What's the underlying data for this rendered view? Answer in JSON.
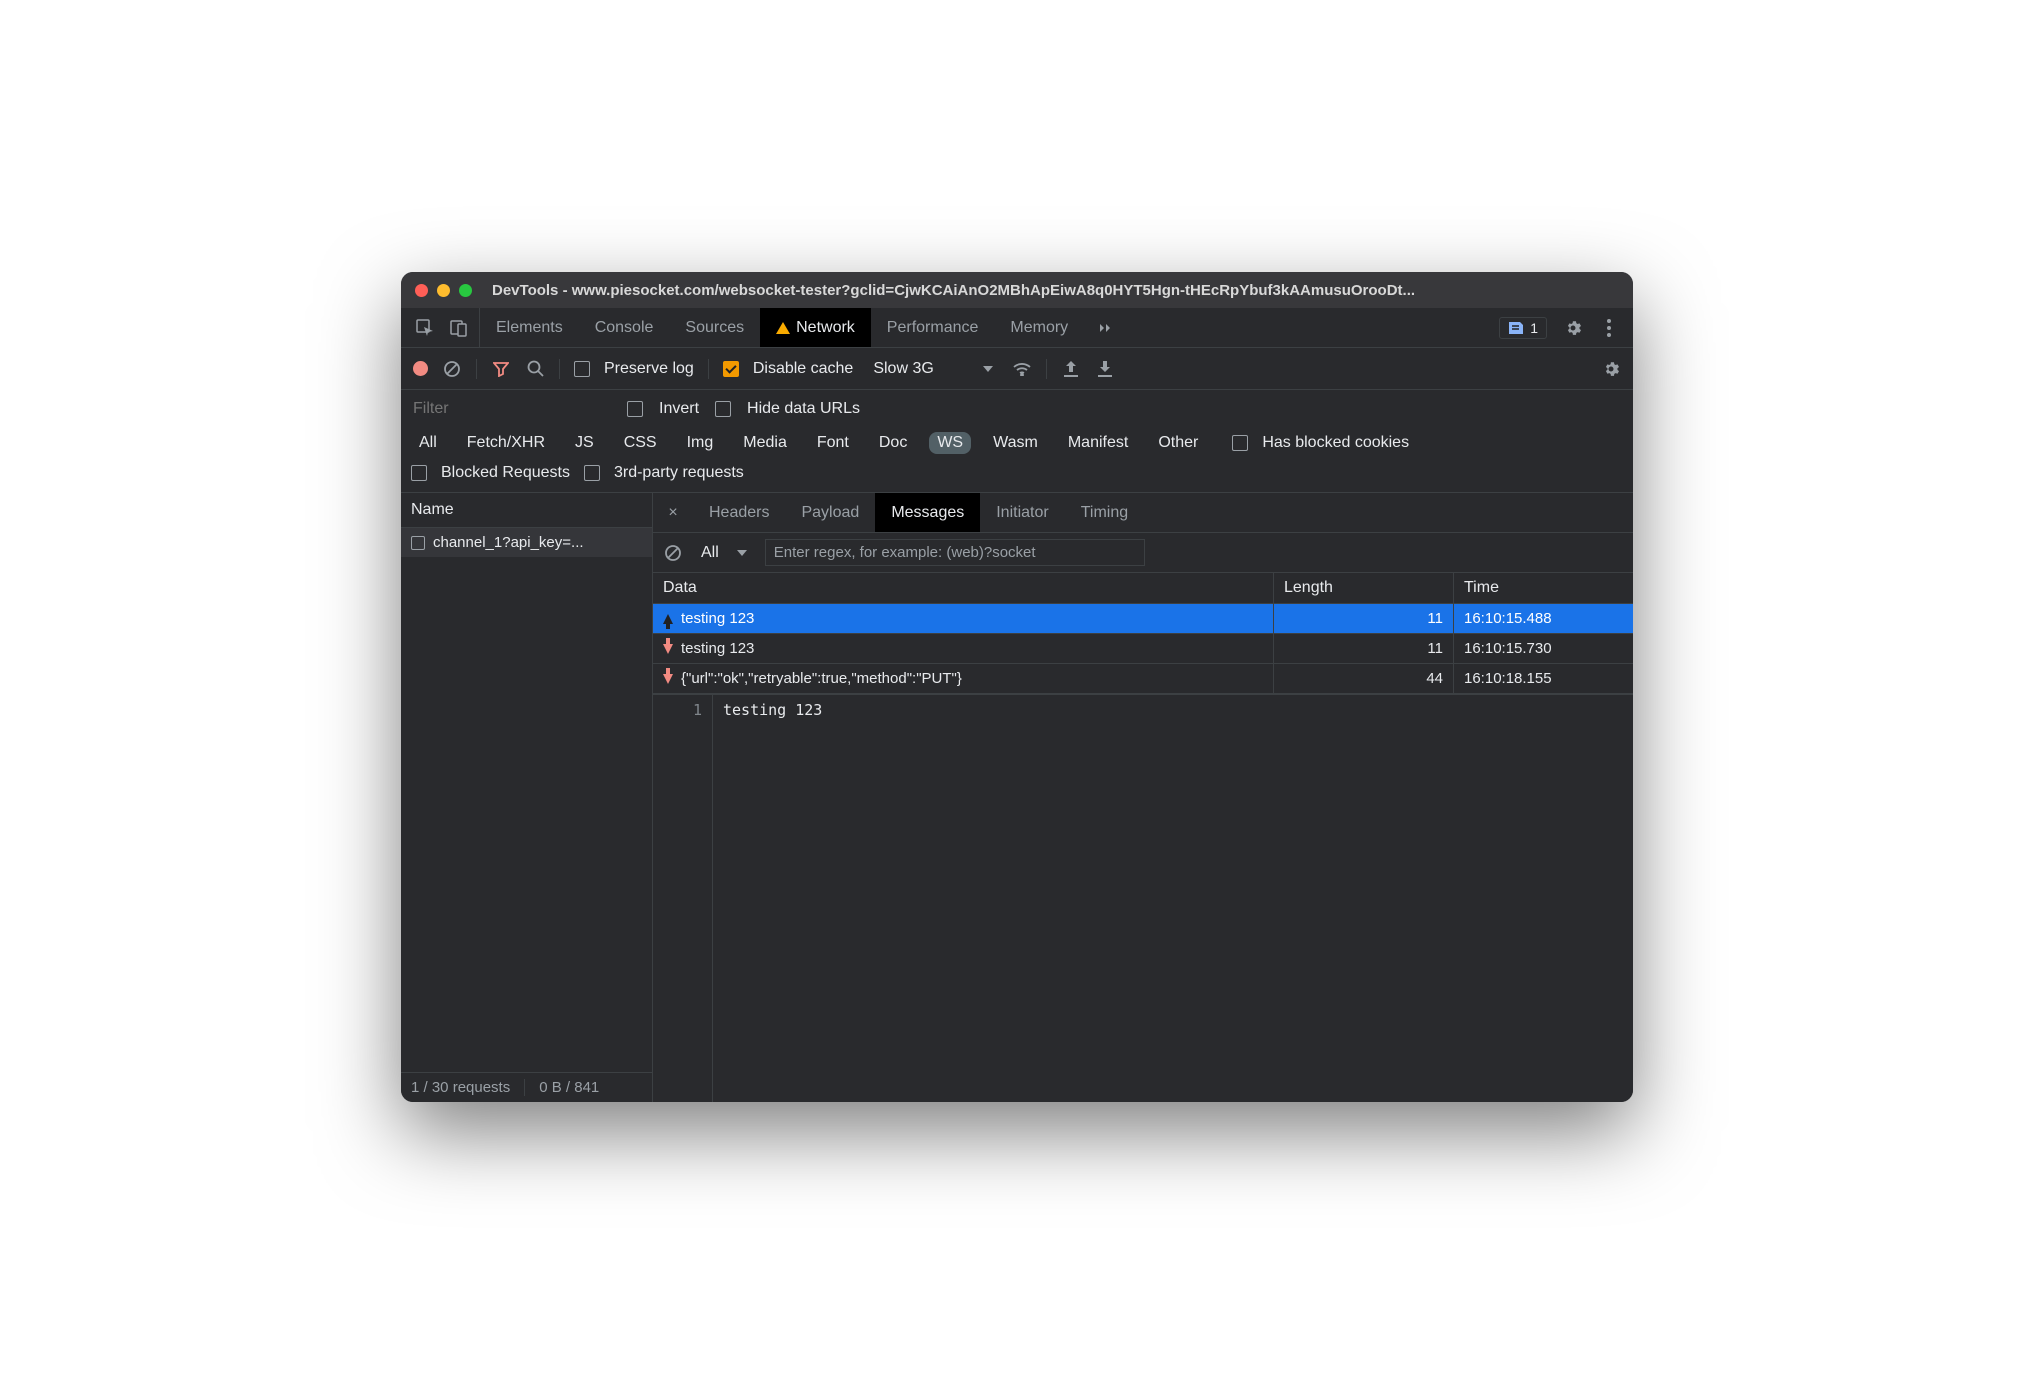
{
  "window": {
    "title": "DevTools - www.piesocket.com/websocket-tester?gclid=CjwKCAiAnO2MBhApEiwA8q0HYT5Hgn-tHEcRpYbuf3kAAmusuOrooDt..."
  },
  "main_tabs": {
    "items": [
      "Elements",
      "Console",
      "Sources",
      "Network",
      "Performance",
      "Memory"
    ],
    "active": "Network",
    "warning_on": "Network",
    "issues_count": "1"
  },
  "toolbar": {
    "preserve_log_label": "Preserve log",
    "preserve_log_checked": false,
    "disable_cache_label": "Disable cache",
    "disable_cache_checked": true,
    "throttling": "Slow 3G"
  },
  "filter": {
    "placeholder": "Filter",
    "invert_label": "Invert",
    "hide_data_urls_label": "Hide data URLs",
    "types": [
      "All",
      "Fetch/XHR",
      "JS",
      "CSS",
      "Img",
      "Media",
      "Font",
      "Doc",
      "WS",
      "Wasm",
      "Manifest",
      "Other"
    ],
    "type_selected": "WS",
    "has_blocked_cookies_label": "Has blocked cookies",
    "blocked_requests_label": "Blocked Requests",
    "third_party_label": "3rd-party requests"
  },
  "requests": {
    "name_header": "Name",
    "items": [
      {
        "name": "channel_1?api_key=..."
      }
    ],
    "footer_left": "1 / 30 requests",
    "footer_right": "0 B / 841"
  },
  "detail": {
    "tabs": [
      "Headers",
      "Payload",
      "Messages",
      "Initiator",
      "Timing"
    ],
    "active": "Messages"
  },
  "messages": {
    "filter_mode": "All",
    "regex_placeholder": "Enter regex, for example: (web)?socket",
    "columns": {
      "data": "Data",
      "length": "Length",
      "time": "Time"
    },
    "rows": [
      {
        "dir": "up",
        "data": "testing 123",
        "length": "11",
        "time": "16:10:15.488",
        "selected": true
      },
      {
        "dir": "down",
        "data": "testing 123",
        "length": "11",
        "time": "16:10:15.730",
        "selected": false
      },
      {
        "dir": "down",
        "data": "{\"url\":\"ok\",\"retryable\":true,\"method\":\"PUT\"}",
        "length": "44",
        "time": "16:10:18.155",
        "selected": false
      }
    ]
  },
  "viewer": {
    "line_number": "1",
    "content": "testing 123"
  }
}
